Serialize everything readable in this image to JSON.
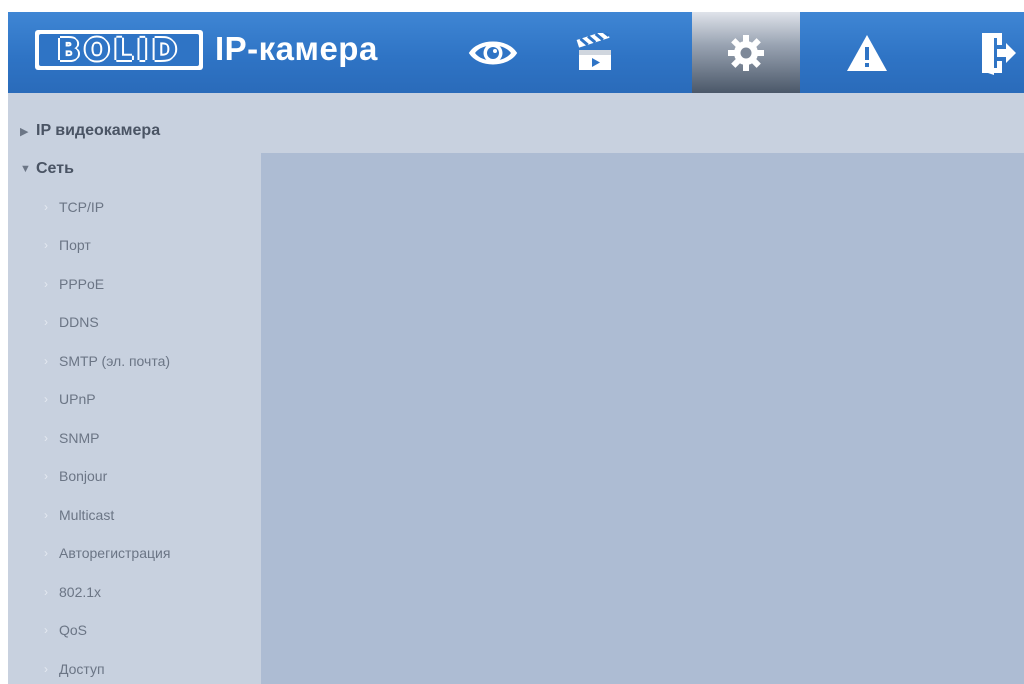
{
  "header": {
    "logo_text": "BOLID",
    "title": "IP-камера",
    "colors": {
      "bar": "#2f74c5",
      "active_tab": "#8e99a9"
    },
    "nav": [
      {
        "id": "live",
        "icon": "eye-icon",
        "active": false
      },
      {
        "id": "playback",
        "icon": "clapperboard-icon",
        "active": false
      },
      {
        "id": "settings",
        "icon": "gear-icon",
        "active": true
      },
      {
        "id": "alarm",
        "icon": "warning-icon",
        "active": false
      },
      {
        "id": "logout",
        "icon": "logout-icon",
        "active": false
      }
    ]
  },
  "sidebar": {
    "groups": [
      {
        "label": "IP видеокамера",
        "expanded": false,
        "icon": "triangle-right-icon"
      },
      {
        "label": "Сеть",
        "expanded": true,
        "icon": "triangle-down-icon"
      }
    ],
    "network_items": [
      {
        "label": "TCP/IP"
      },
      {
        "label": "Порт"
      },
      {
        "label": "PPPoE"
      },
      {
        "label": "DDNS"
      },
      {
        "label": "SMTP (эл. почта)"
      },
      {
        "label": "UPnP"
      },
      {
        "label": "SNMP"
      },
      {
        "label": "Bonjour"
      },
      {
        "label": "Multicast"
      },
      {
        "label": "Авторегистрация"
      },
      {
        "label": "802.1x"
      },
      {
        "label": "QoS"
      },
      {
        "label": "Доступ"
      }
    ]
  }
}
